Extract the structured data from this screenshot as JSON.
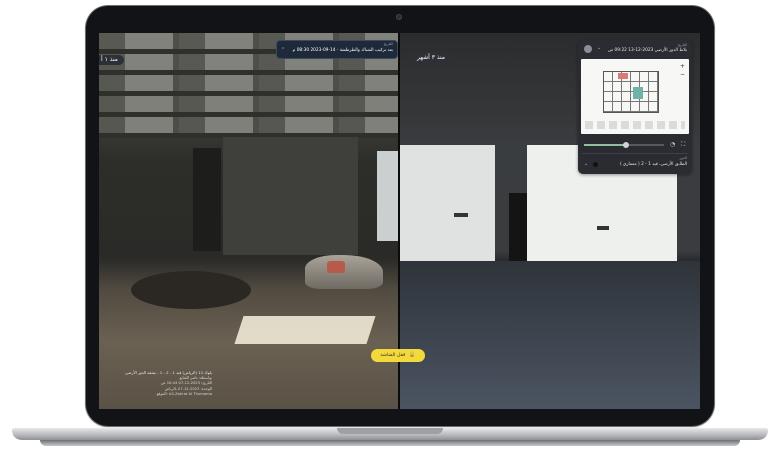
{
  "left_view": {
    "time_label": "منذ ١ أ",
    "date_label": "التاريخ",
    "date_value": "بعد ترکیب الشباك والطرطشة - 14-09-2023 08:30 م",
    "info": {
      "title": "بلوك 11 (الرياض) قيد 1 - 2 - 1 - بشقه الدور الأرضي",
      "rows": [
        "بواسطة: ناصر الشايع",
        "التاريخ: 2023-12-07 10:44 ص",
        "الوحدة: 2023-12-07 بالرياض",
        "الموقع: AS-Zahrat Al Thumama"
      ]
    }
  },
  "right_view": {
    "time_label": "منذ ٣ أشهر",
    "panel": {
      "date_label": "التاريخ",
      "date_value": "بلاط الدور الأرضي 2023-12-13 09:22 ص",
      "zoom_in": "+",
      "zoom_out": "−",
      "floor_label": "الدور",
      "floor_value": "الطابق الأرضي، قيد 1 - 2 ( معماري )",
      "progress": 0.52
    }
  },
  "lock_button": {
    "label": "قفل الشاشة",
    "icon": "lock-icon"
  },
  "colors": {
    "accent": "#f3d93c",
    "panel": "#2a2c31",
    "chip": "#1e2a3a"
  }
}
